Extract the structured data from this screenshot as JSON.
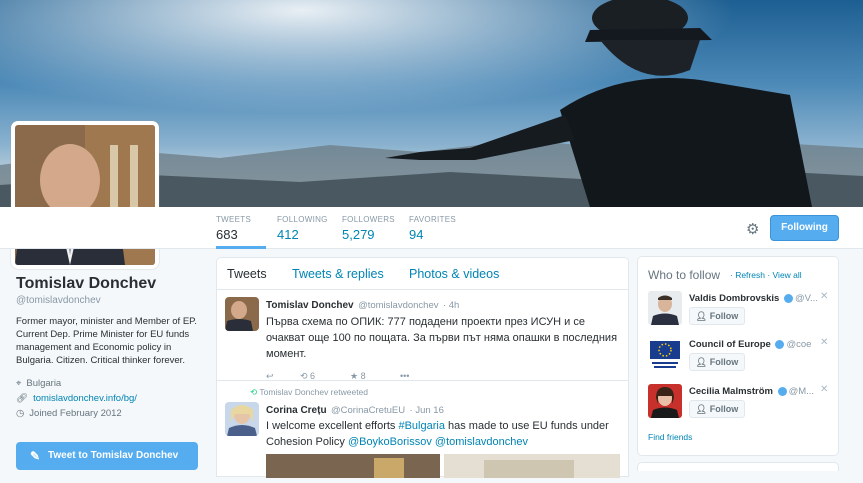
{
  "profile": {
    "name": "Tomislav Donchev",
    "handle": "@tomislavdonchev",
    "bio": "Former mayor, minister and Member of EP. Current Dep. Prime Minister for EU funds management and Economic policy in Bulgaria. Citizen. Critical thinker forever.",
    "location": "Bulgaria",
    "website": "tomislavdonchev.info/bg/",
    "joined": "Joined February 2012",
    "tweet_to_label": "Tweet to Tomislav Donchev"
  },
  "stats": [
    {
      "label": "TWEETS",
      "value": "683"
    },
    {
      "label": "FOLLOWING",
      "value": "412"
    },
    {
      "label": "FOLLOWERS",
      "value": "5,279"
    },
    {
      "label": "FAVORITES",
      "value": "94"
    }
  ],
  "following_button": "Following",
  "timeline": {
    "tabs": [
      "Tweets",
      "Tweets & replies",
      "Photos & videos"
    ],
    "tweets": [
      {
        "name": "Tomislav Donchev",
        "handle": "@tomislavdonchev",
        "time": "· 4h",
        "text": "Първа схема по ОПИК: 777 подадени проекти през ИСУН и се очакват още 100 по пощата. За първи път няма опашки в последния момент.",
        "retweets": "6",
        "favorites": "8"
      },
      {
        "retweeted_by": "Tomislav Donchev retweeted",
        "name": "Corina Crețu",
        "handle": "@CorinaCretuEU",
        "time": "· Jun 16",
        "text_parts": [
          "I welcome excellent efforts ",
          "#Bulgaria",
          " has made to use EU funds under Cohesion Policy ",
          "@BoykoBorissov",
          " ",
          "@tomislavdonchev"
        ]
      }
    ]
  },
  "who_to_follow": {
    "title": "Who to follow",
    "refresh": "· Refresh",
    "view_all": "· View all",
    "follow_label": "Follow",
    "accounts": [
      {
        "name": "Valdis Dombrovskis",
        "handle": "@V..."
      },
      {
        "name": "Council of Europe",
        "handle": "@coe"
      },
      {
        "name": "Cecilia Malmström",
        "handle": "@M..."
      }
    ],
    "find_friends": "Find friends"
  },
  "colors": {
    "accent": "#55acee",
    "link": "#0084b4",
    "text": "#292f33",
    "muted": "#8899a6"
  },
  "icons": [
    "gear-icon",
    "location-icon",
    "link-icon",
    "calendar-icon",
    "reply-icon",
    "retweet-icon",
    "favorite-icon",
    "more-icon",
    "verified-icon",
    "close-icon",
    "follow-icon",
    "compose-icon"
  ]
}
